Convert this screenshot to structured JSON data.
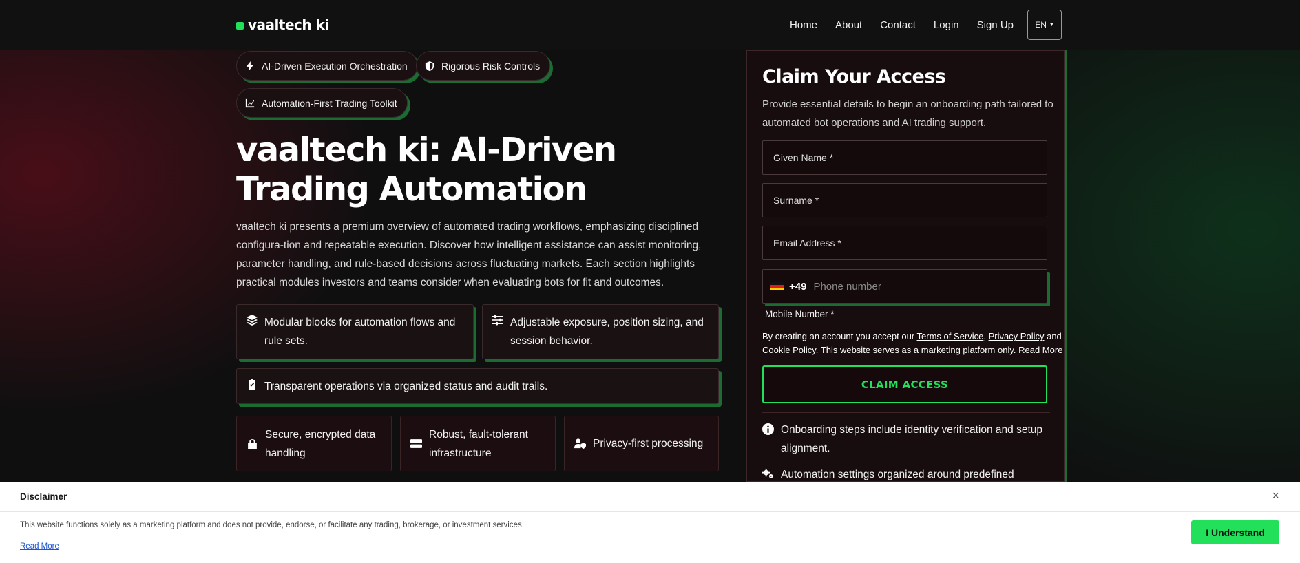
{
  "header": {
    "brand": "vaaltech ki",
    "nav": [
      "Home",
      "About",
      "Contact",
      "Login",
      "Sign Up"
    ],
    "language": "EN"
  },
  "hero": {
    "chips": [
      {
        "label": "AI-Driven Execution Orchestration",
        "icon": "bolt-icon"
      },
      {
        "label": "Rigorous Risk Controls",
        "icon": "shield-icon"
      },
      {
        "label": "Automation-First Trading Toolkit",
        "icon": "chart-line-icon"
      }
    ],
    "title": "vaaltech ki: AI-Driven Trading Automation",
    "description": "vaaltech ki presents a premium overview of automated trading workflows, emphasizing disciplined configura-tion and repeatable execution. Discover how intelligent assistance can assist monitoring, parameter handling, and rule-based decisions across fluctuating markets. Each section highlights practical modules investors and teams consider when evaluating bots for fit and outcomes."
  },
  "features": [
    {
      "label": "Modular blocks for automation flows and rule sets.",
      "icon": "layers-icon"
    },
    {
      "label": "Adjustable exposure, position sizing, and session behavior.",
      "icon": "sliders-icon"
    },
    {
      "label": "Transparent operations via organized status and audit trails.",
      "icon": "clipboard-check-icon"
    }
  ],
  "badges": [
    {
      "label": "Secure, encrypted data handling",
      "icon": "lock-icon"
    },
    {
      "label": "Robust, fault-tolerant infrastructure",
      "icon": "server-icon"
    },
    {
      "label": "Privacy-first processing",
      "icon": "user-shield-icon"
    }
  ],
  "form": {
    "title": "Claim Your Access",
    "subtitle": "Provide essential details to begin an onboarding path tailored to automated bot operations and AI trading support.",
    "given_name": "Given Name *",
    "surname": "Surname *",
    "email": "Email Address *",
    "dial_code": "+49",
    "phone_placeholder": "Phone number",
    "mobile_label": "Mobile Number *",
    "legal_prefix": "By creating an account you accept our ",
    "terms": "Terms of Service",
    "privacy": "Privacy Policy",
    "and": " and ",
    "cookie": "Cookie Policy",
    "legal_suffix": ". This website serves as a marketing platform only. ",
    "read_more": "Read More",
    "submit": "CLAIM ACCESS",
    "info": [
      {
        "label": "Onboarding steps include identity verification and setup alignment.",
        "icon": "info-icon"
      },
      {
        "label": "Automation settings organized around predefined",
        "icon": "gears-icon"
      }
    ]
  },
  "disclaimer": {
    "title": "Disclaimer",
    "close": "×",
    "text": "This website functions solely as a marketing platform and does not provide, endorse, or facilitate any trading, brokerage, or investment services.",
    "link": "Read More",
    "button": "I Understand"
  },
  "colors": {
    "accent": "#22e05a",
    "shadow_green": "#1b6b33",
    "card_bg": "#170d0f"
  }
}
